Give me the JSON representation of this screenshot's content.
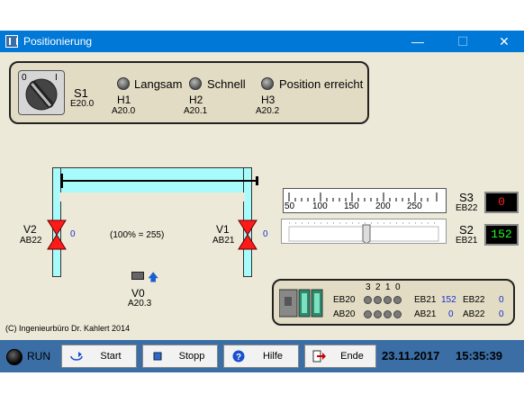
{
  "window": {
    "title": "Positionierung",
    "minimize": "—",
    "maximize": "☐",
    "close": "✕"
  },
  "switch": {
    "name": "S1",
    "address": "E20.0",
    "left_mark": "0",
    "right_mark": "I"
  },
  "lamps": [
    {
      "label": "Langsam",
      "name": "H1",
      "address": "A20.0"
    },
    {
      "label": "Schnell",
      "name": "H2",
      "address": "A20.1"
    },
    {
      "label": "Position erreicht",
      "name": "H3",
      "address": "A20.2"
    }
  ],
  "valves": {
    "v2": {
      "name": "V2",
      "address": "AB22",
      "value": "0"
    },
    "v1": {
      "name": "V1",
      "address": "AB21",
      "value": "0"
    },
    "note": "(100% = 255)"
  },
  "sensor": {
    "name": "V0",
    "address": "A20.3"
  },
  "scale": {
    "ticks": [
      "50",
      "100",
      "150",
      "200",
      "250"
    ]
  },
  "s3": {
    "name": "S3",
    "address": "EB22",
    "value": "0",
    "color": "#ff2020"
  },
  "s2": {
    "name": "S2",
    "address": "EB21",
    "value": "152",
    "color": "#20ff20"
  },
  "io": {
    "bits": [
      "3",
      "2",
      "1",
      "0"
    ],
    "eb20": "EB20",
    "ab20": "AB20",
    "eb21_label": "EB21",
    "eb21_value": "152",
    "eb22_label": "EB22",
    "eb22_value": "0",
    "ab21_label": "AB21",
    "ab21_value": "0",
    "ab22_label": "AB22",
    "ab22_value": "0"
  },
  "copyright": "(C) Ingenieurbüro Dr. Kahlert 2014",
  "statusbar": {
    "run": "RUN",
    "start": "Start",
    "stopp": "Stopp",
    "hilfe": "Hilfe",
    "ende": "Ende",
    "date": "23.11.2017",
    "time": "15:35:39"
  }
}
